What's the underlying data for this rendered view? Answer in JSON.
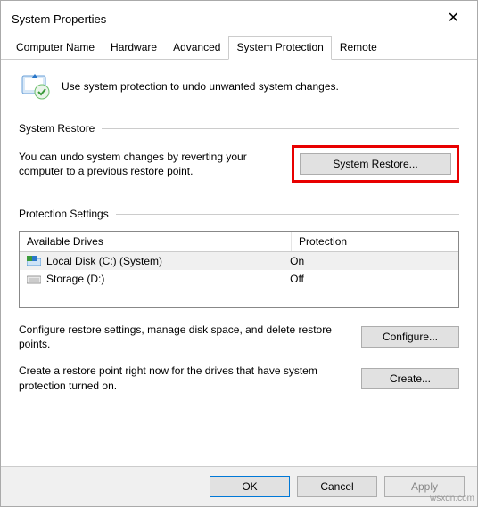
{
  "window_title": "System Properties",
  "tabs": {
    "computer_name": "Computer Name",
    "hardware": "Hardware",
    "advanced": "Advanced",
    "system_protection": "System Protection",
    "remote": "Remote"
  },
  "intro_text": "Use system protection to undo unwanted system changes.",
  "sections": {
    "restore_header": "System Restore",
    "restore_text": "You can undo system changes by reverting your computer to a previous restore point.",
    "restore_button": "System Restore...",
    "protection_header": "Protection Settings",
    "drives_header": {
      "drive": "Available Drives",
      "protection": "Protection"
    },
    "drives": [
      {
        "name": "Local Disk (C:) (System)",
        "protection": "On"
      },
      {
        "name": "Storage (D:)",
        "protection": "Off"
      }
    ],
    "configure_text": "Configure restore settings, manage disk space, and delete restore points.",
    "configure_button": "Configure...",
    "create_text": "Create a restore point right now for the drives that have system protection turned on.",
    "create_button": "Create..."
  },
  "footer": {
    "ok": "OK",
    "cancel": "Cancel",
    "apply": "Apply"
  },
  "watermark": "wsxdn.com"
}
